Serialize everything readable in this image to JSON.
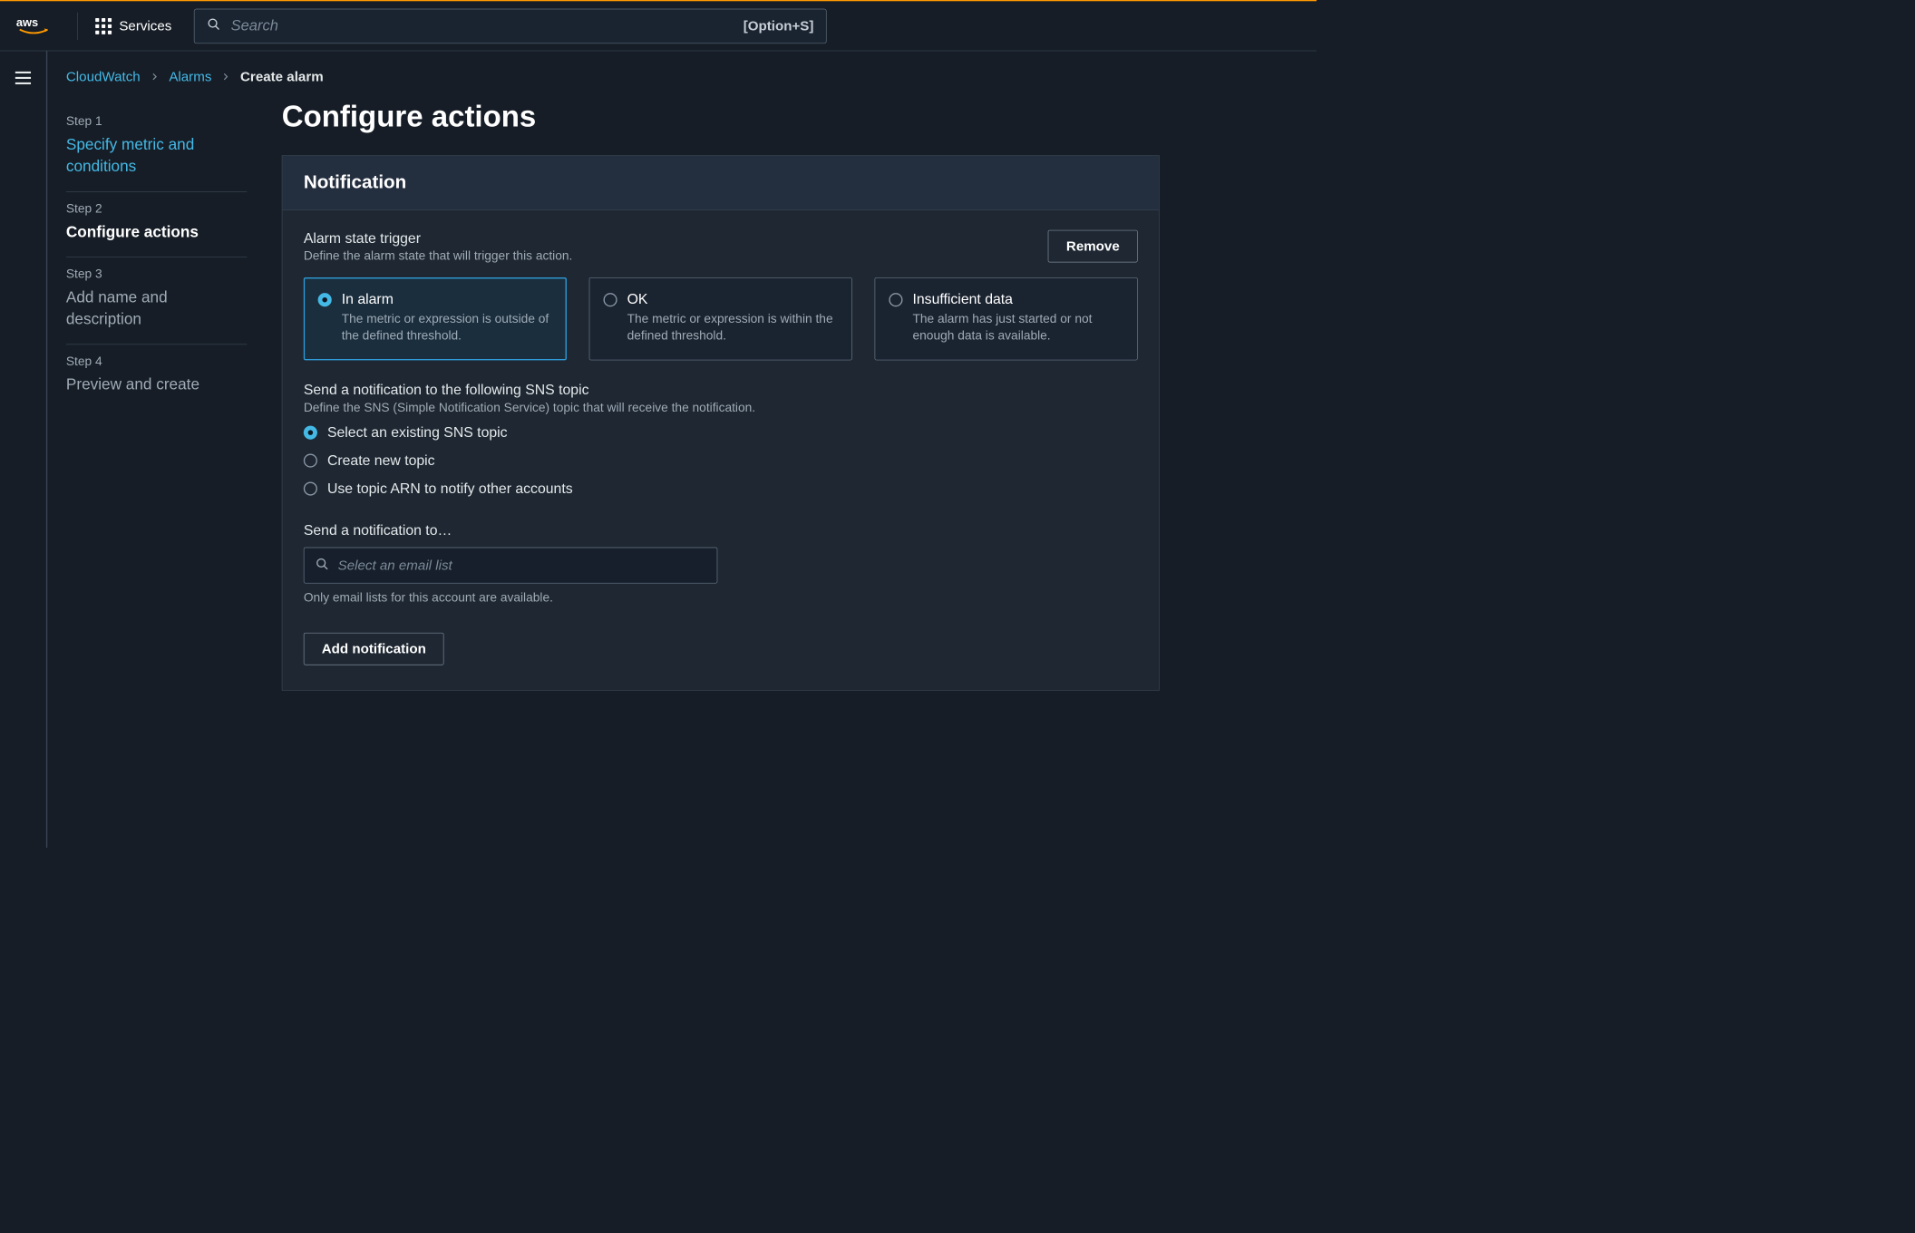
{
  "topnav": {
    "services_label": "Services",
    "search_placeholder": "Search",
    "search_kbd": "[Option+S]"
  },
  "breadcrumbs": {
    "root": "CloudWatch",
    "mid": "Alarms",
    "current": "Create alarm"
  },
  "steps": [
    {
      "n": "Step 1",
      "title": "Specify metric and conditions",
      "state": "link"
    },
    {
      "n": "Step 2",
      "title": "Configure actions",
      "state": "active"
    },
    {
      "n": "Step 3",
      "title": "Add name and description",
      "state": "future"
    },
    {
      "n": "Step 4",
      "title": "Preview and create",
      "state": "future"
    }
  ],
  "page_title": "Configure actions",
  "panel": {
    "heading": "Notification",
    "trigger": {
      "label": "Alarm state trigger",
      "desc": "Define the alarm state that will trigger this action.",
      "remove_label": "Remove",
      "options": [
        {
          "name": "In alarm",
          "desc": "The metric or expression is outside of the defined threshold.",
          "selected": true
        },
        {
          "name": "OK",
          "desc": "The metric or expression is within the defined threshold.",
          "selected": false
        },
        {
          "name": "Insufficient data",
          "desc": "The alarm has just started or not enough data is available.",
          "selected": false
        }
      ]
    },
    "sns": {
      "label": "Send a notification to the following SNS topic",
      "desc": "Define the SNS (Simple Notification Service) topic that will receive the notification.",
      "options": [
        {
          "label": "Select an existing SNS topic",
          "selected": true
        },
        {
          "label": "Create new topic",
          "selected": false
        },
        {
          "label": "Use topic ARN to notify other accounts",
          "selected": false
        }
      ]
    },
    "send_to": {
      "label": "Send a notification to…",
      "placeholder": "Select an email list",
      "hint": "Only email lists for this account are available."
    },
    "add_label": "Add notification"
  }
}
